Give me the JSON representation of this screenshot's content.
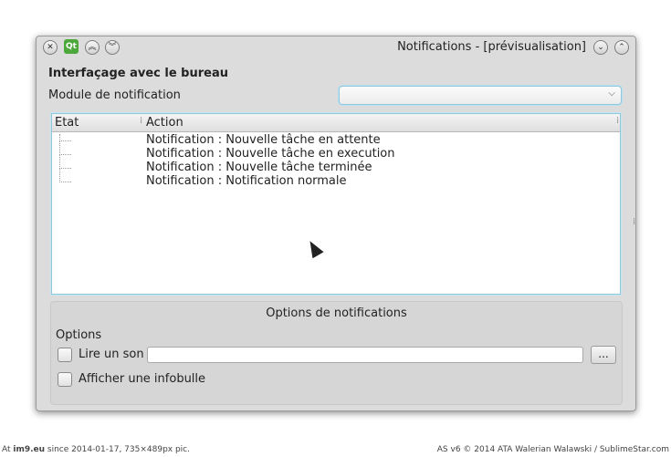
{
  "window": {
    "title": "Notifications - [prévisualisation]",
    "app_icon_text": "Qt",
    "buttons": {
      "close": "✕",
      "pin": "⇧",
      "shade_up": "︽",
      "shade_down": "︾",
      "minimize": "⌄",
      "maximize": "⌃"
    }
  },
  "desktop_section": {
    "title": "Interfaçage avec le bureau",
    "module_label": "Module de notification",
    "module_value": "",
    "module_arrow": "⌵"
  },
  "tree": {
    "columns": [
      "Etat",
      "Action"
    ],
    "rows": [
      {
        "state": "",
        "action": "Notification : Nouvelle tâche en attente"
      },
      {
        "state": "",
        "action": "Notification : Nouvelle tâche en execution"
      },
      {
        "state": "",
        "action": "Notification : Nouvelle tâche terminée"
      },
      {
        "state": "",
        "action": "Notification : Notification normale"
      }
    ]
  },
  "options_group": {
    "title": "Options de notifications",
    "options_label": "Options",
    "play_sound_label": "Lire un son",
    "sound_path_value": "",
    "browse_label": "...",
    "show_tooltip_label": "Afficher une infobulle"
  },
  "footer": {
    "left_prefix": "At ",
    "left_site": "im9.eu",
    "left_rest": " since 2014-01-17, 735×489px pic.",
    "right_text": "AS v6 © 2014 ATA Walerian Walawski / SublimeStar.com"
  }
}
